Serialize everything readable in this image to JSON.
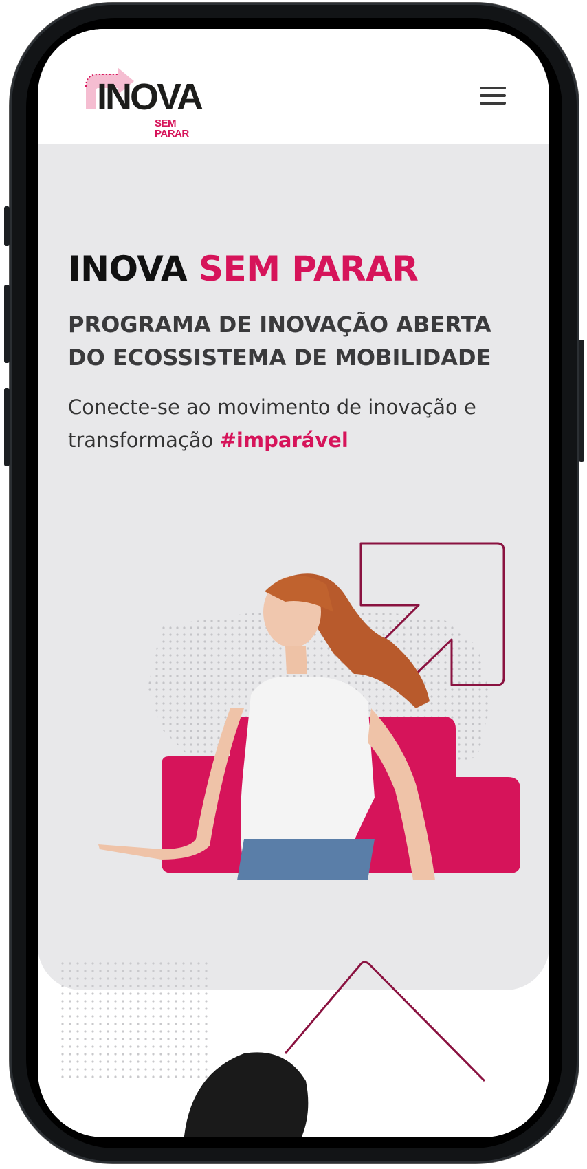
{
  "header": {
    "logo_text": "INOVA",
    "logo_subtext": "SEM PARAR",
    "menu_icon": "hamburger-menu-icon"
  },
  "hero": {
    "title_main": "INOVA",
    "title_accent": "SEM PARAR",
    "subtitle": "PROGRAMA DE INOVAÇÃO ABERTA DO ECOSSISTEMA DE MOBILIDADE",
    "text": "Conecte-se ao movimento de inovação e transformação",
    "hashtag": "#imparável"
  },
  "colors": {
    "accent": "#d6145a",
    "hero_background": "#e8e8ea",
    "text_dark": "#111111",
    "outline_arrow": "#8a1240"
  }
}
